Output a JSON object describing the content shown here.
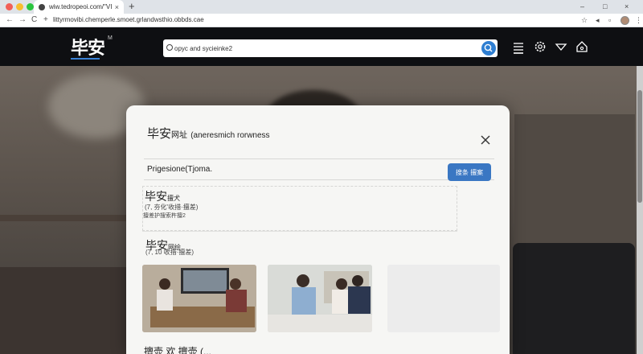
{
  "browser": {
    "tab_title": "wiw.tedropeoi.com/\"VIK.",
    "tab_close": "×",
    "new_tab": "+",
    "window_controls": [
      "–",
      "□",
      "×"
    ],
    "nav": {
      "back": "←",
      "forward": "→",
      "reload": "C",
      "home": "+"
    },
    "url": "littyrmovibi.chemperle.smoet.grlandwsthio.obbds.cae",
    "toolbar_icons": [
      "star-icon",
      "speaker-icon",
      "extension-icon",
      "profile-icon",
      "menu-icon"
    ]
  },
  "site": {
    "logo": "毕安",
    "logo_mark": "M",
    "search_value": "opyc and sycieinke2",
    "accent": "#2f7fd2"
  },
  "modal": {
    "title_main": "毕安",
    "title_small": "网址",
    "title_rest": "(aneresmich rorwness",
    "close": "×",
    "form_label": "Prigesione(Tjoma.",
    "form_button": "搜条 擅案",
    "card1": {
      "title_main": "毕安",
      "title_small": "擅犬",
      "sub": "(7, 夯化'收措·擅差)",
      "desc": "擅差护搜索杵擅2"
    },
    "section": {
      "title_main": "毕安",
      "title_small": "网绘",
      "sub": "(7, 10 收措·擅差)"
    },
    "bottom_label": "擅壶 欢 擅壶 (..."
  }
}
